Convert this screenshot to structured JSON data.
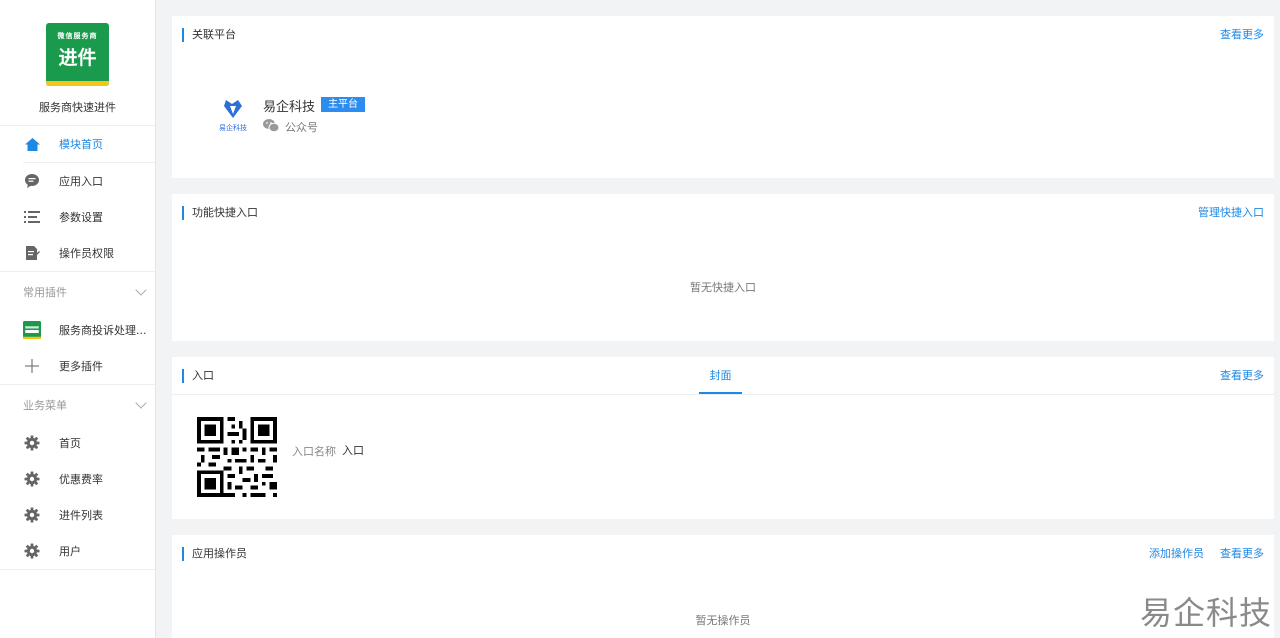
{
  "app": {
    "logo_top": "微信服务商",
    "logo_main": "进件",
    "name": "服务商快速进件"
  },
  "nav": {
    "items": [
      {
        "label": "模块首页",
        "icon": "home-icon"
      },
      {
        "label": "应用入口",
        "icon": "chat-icon"
      },
      {
        "label": "参数设置",
        "icon": "list-icon"
      },
      {
        "label": "操作员权限",
        "icon": "doc-edit-icon"
      }
    ],
    "plugins_group": "常用插件",
    "plugins": [
      {
        "label": "服务商投诉处理...",
        "icon": "plugin-thumb-icon"
      },
      {
        "label": "更多插件",
        "icon": "plus-icon"
      }
    ],
    "menu_group": "业务菜单",
    "menu": [
      {
        "label": "首页",
        "icon": "gear-icon"
      },
      {
        "label": "优惠费率",
        "icon": "gear-icon"
      },
      {
        "label": "进件列表",
        "icon": "gear-icon"
      },
      {
        "label": "用户",
        "icon": "gear-icon"
      }
    ]
  },
  "platform": {
    "title": "关联平台",
    "more": "查看更多",
    "logo_text": "易企科技",
    "name": "易企科技",
    "badge": "主平台",
    "type": "公众号"
  },
  "shortcuts": {
    "title": "功能快捷入口",
    "manage": "管理快捷入口",
    "empty": "暂无快捷入口"
  },
  "entry": {
    "title": "入口",
    "tab": "封面",
    "more": "查看更多",
    "name_label": "入口名称",
    "name_value": "入口"
  },
  "operators": {
    "title": "应用操作员",
    "add": "添加操作员",
    "more": "查看更多",
    "empty": "暂无操作员"
  },
  "watermark": "易企科技",
  "colors": {
    "accent": "#1e88e5",
    "badge": "#2d8cf0",
    "logo_green": "#1a9a4c"
  }
}
